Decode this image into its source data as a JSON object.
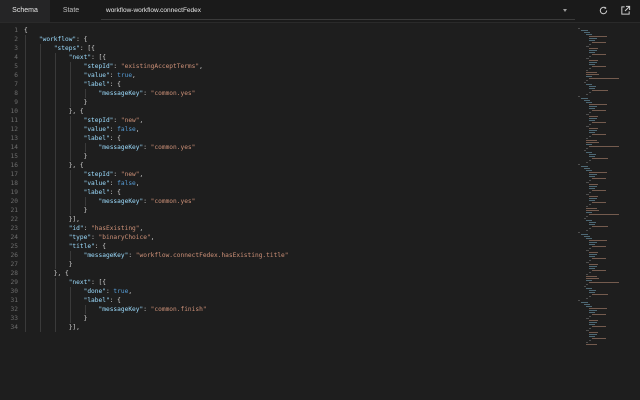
{
  "tabs": [
    {
      "label": "Schema",
      "active": true
    },
    {
      "label": "State",
      "active": false
    }
  ],
  "selector": {
    "value": "workflow-workflow.connectFedex"
  },
  "icons": {
    "refresh": "refresh-icon",
    "open": "open-external-icon"
  },
  "colors": {
    "background": "#1e1e1e",
    "key": "#9cdcfe",
    "string": "#ce9178",
    "keyword": "#569cd6",
    "line_number": "#6e6e6e"
  },
  "editor": {
    "lines": [
      "{",
      "    \"workflow\": {",
      "        \"steps\": [{",
      "            \"next\": [{",
      "                \"stepId\": \"existingAcceptTerms\",",
      "                \"value\": true,",
      "                \"label\": {",
      "                    \"messageKey\": \"common.yes\"",
      "                }",
      "            }, {",
      "                \"stepId\": \"new\",",
      "                \"value\": false,",
      "                \"label\": {",
      "                    \"messageKey\": \"common.yes\"",
      "                }",
      "            }, {",
      "                \"stepId\": \"new\",",
      "                \"value\": false,",
      "                \"label\": {",
      "                    \"messageKey\": \"common.yes\"",
      "                }",
      "            }],",
      "            \"id\": \"hasExisting\",",
      "            \"type\": \"binaryChoice\",",
      "            \"title\": {",
      "                \"messageKey\": \"workflow.connectFedex.hasExisting.title\"",
      "            }",
      "        }, {",
      "            \"next\": [{",
      "                \"done\": true,",
      "                \"label\": {",
      "                    \"messageKey\": \"common.finish\"",
      "                }",
      "            }],"
    ]
  }
}
